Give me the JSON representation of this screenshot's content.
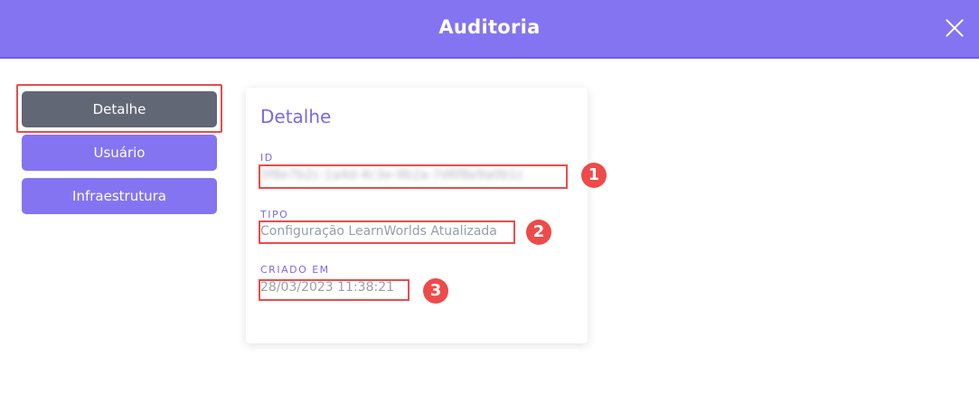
{
  "header": {
    "title": "Auditoria"
  },
  "nav": {
    "items": [
      {
        "label": "Detalhe",
        "active": true
      },
      {
        "label": "Usuário",
        "active": false
      },
      {
        "label": "Infraestrutura",
        "active": false
      }
    ]
  },
  "card": {
    "title": "Detalhe",
    "fields": [
      {
        "label": "ID",
        "value": "5f8e7b2c-1a4d-4c3e-9b2a-7d6f8e9a0b1c",
        "redacted": true
      },
      {
        "label": "TIPO",
        "value": "Configuração LearnWorlds Atualizada"
      },
      {
        "label": "CRIADO EM",
        "value": "28/03/2023 11:38:21"
      }
    ]
  },
  "annotations": {
    "badges": [
      "1",
      "2",
      "3"
    ],
    "color": "#ee4a4a"
  },
  "colors": {
    "primary": "#8474f2",
    "active_nav": "#626776",
    "label": "#7a6ae8"
  }
}
